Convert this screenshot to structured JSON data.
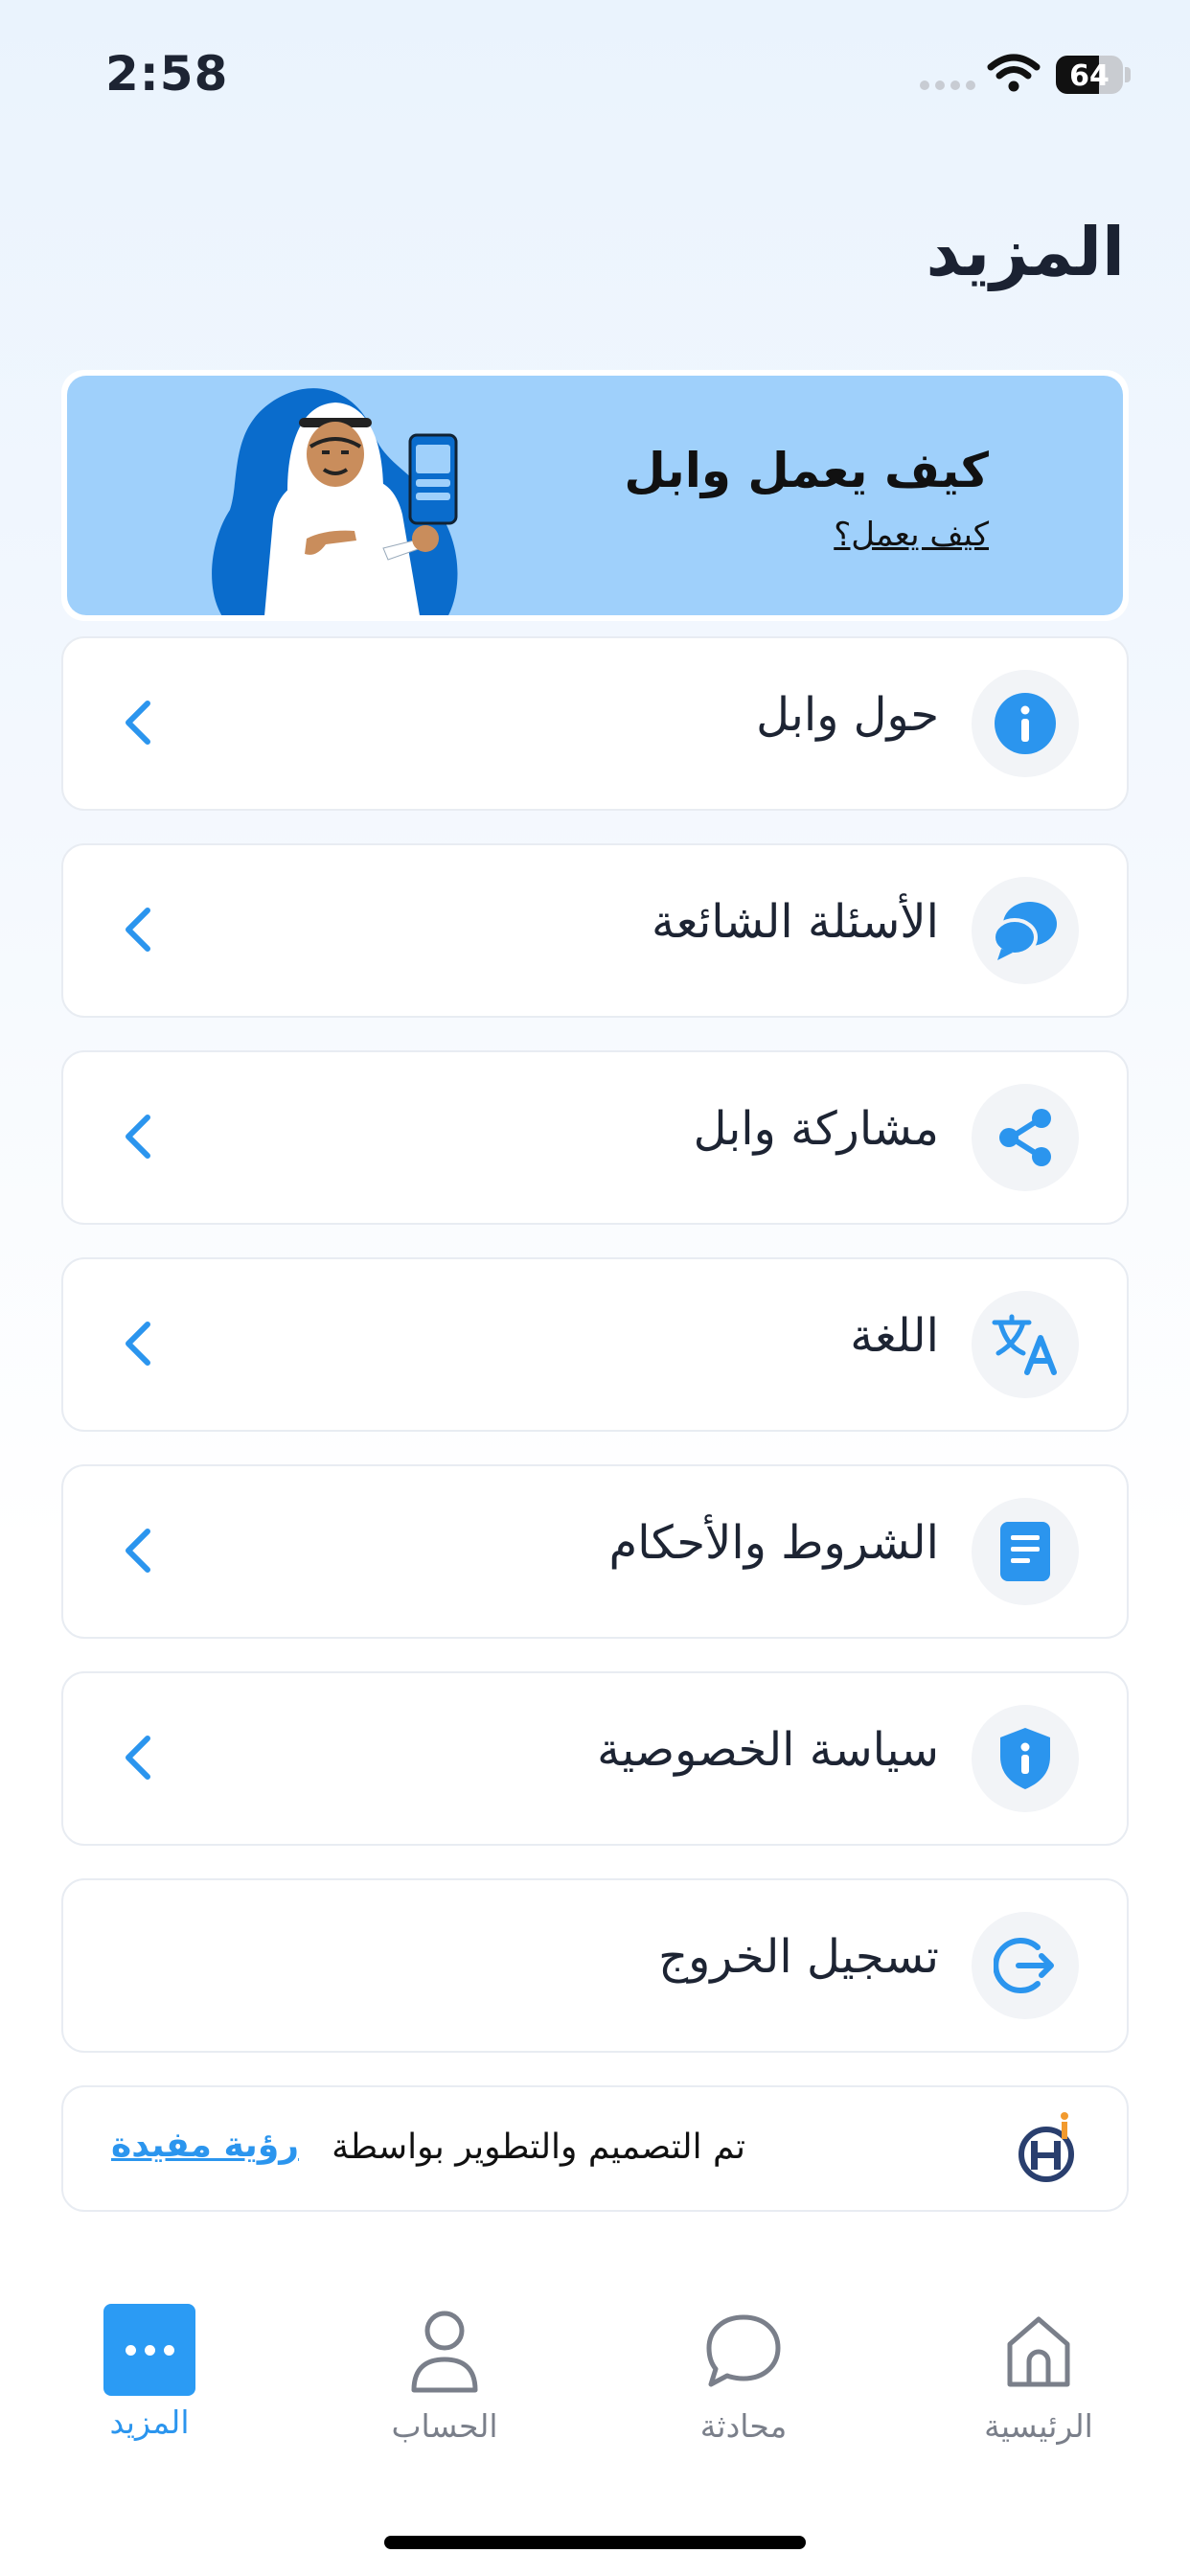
{
  "status_bar": {
    "time": "2:58",
    "battery": "64",
    "battery_level": 0.64
  },
  "page": {
    "title": "المزيد"
  },
  "banner": {
    "title": "كيف يعمل وابل",
    "link": "كيف يعمل؟"
  },
  "menu": {
    "items": [
      {
        "label": "حول وابل",
        "icon": "info-icon"
      },
      {
        "label": "الأسئلة الشائعة",
        "icon": "chat-bubbles-icon"
      },
      {
        "label": "مشاركة وابل",
        "icon": "share-icon"
      },
      {
        "label": "اللغة",
        "icon": "translate-icon"
      },
      {
        "label": "الشروط والأحكام",
        "icon": "document-icon"
      },
      {
        "label": "سياسة الخصوصية",
        "icon": "shield-icon"
      },
      {
        "label": "تسجيل الخروج",
        "icon": "logout-icon"
      }
    ]
  },
  "credit": {
    "text": "تم التصميم والتطوير بواسطة",
    "link": "رؤية مفيدة"
  },
  "tabbar": {
    "items": [
      {
        "label": "المزيد",
        "icon": "more-icon",
        "active": true
      },
      {
        "label": "الحساب",
        "icon": "user-icon",
        "active": false
      },
      {
        "label": "محادثة",
        "icon": "chat-icon",
        "active": false
      },
      {
        "label": "الرئيسية",
        "icon": "home-icon",
        "active": false
      }
    ]
  },
  "colors": {
    "accent": "#2b95ee",
    "banner_bg": "#9fd0fb",
    "text": "#1d2433"
  }
}
